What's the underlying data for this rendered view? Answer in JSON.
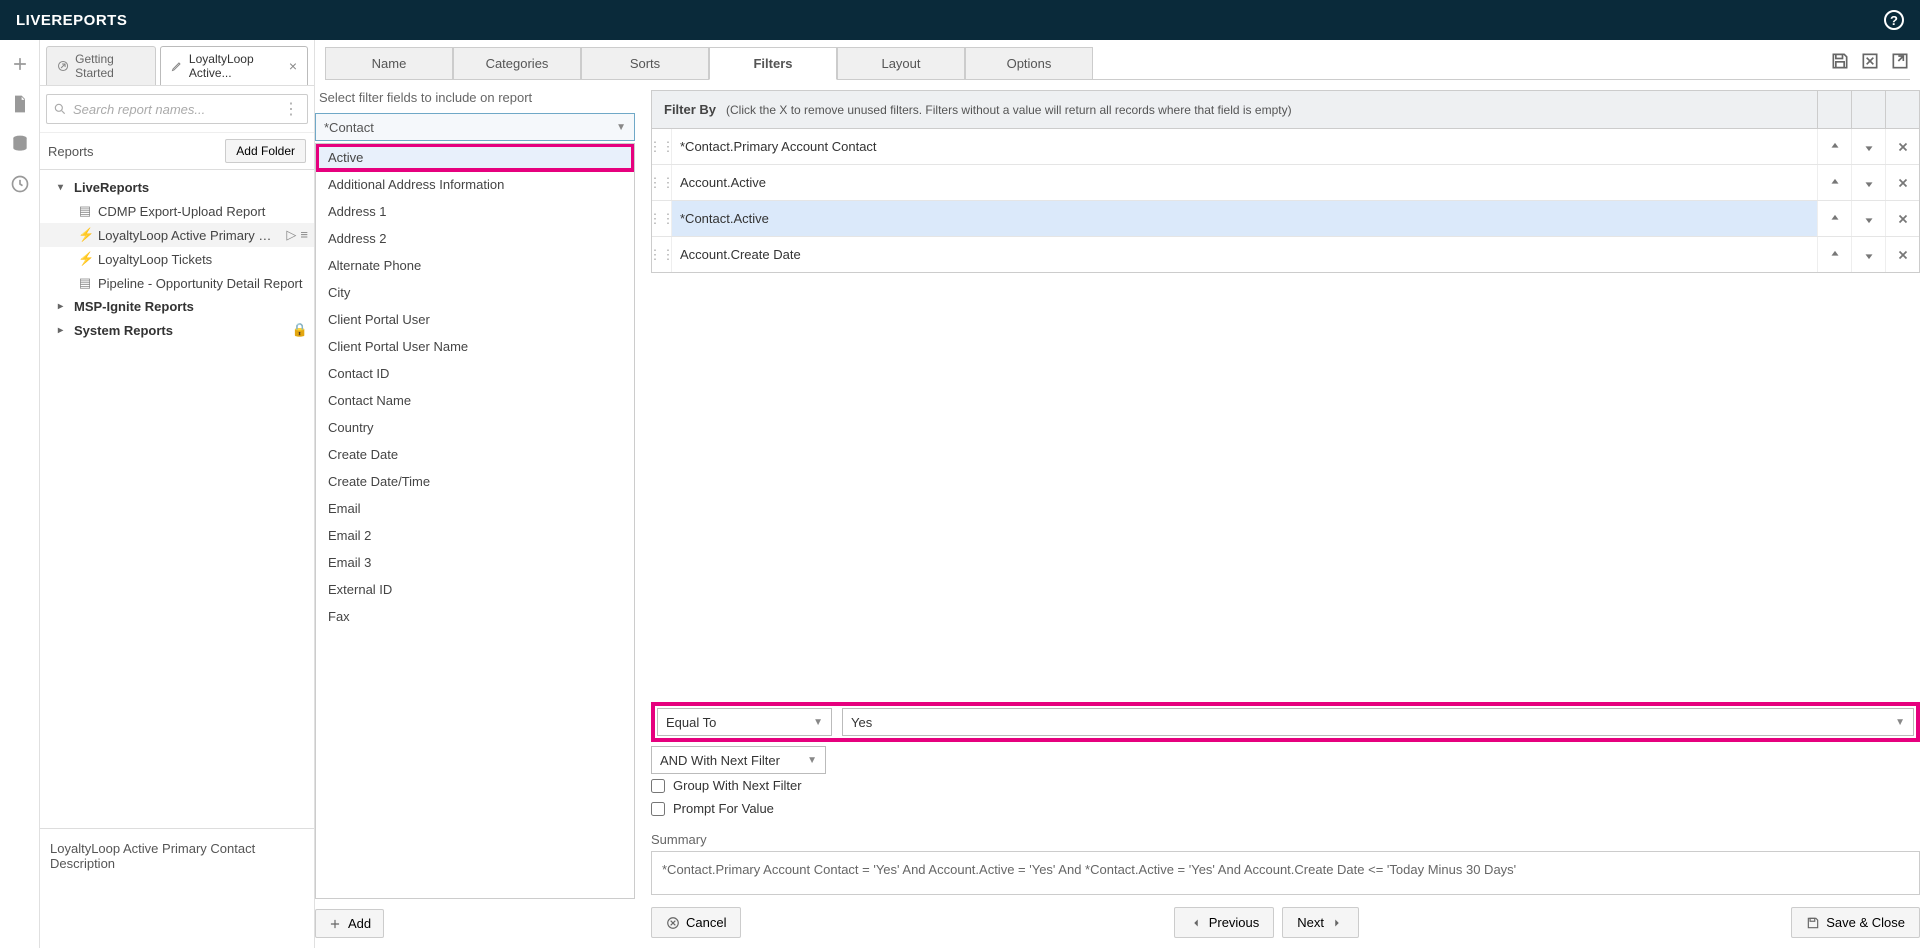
{
  "app": {
    "title": "LIVEREPORTS"
  },
  "tabs": [
    {
      "label": "Getting Started",
      "closable": false,
      "active": false
    },
    {
      "label": "LoyaltyLoop Active...",
      "closable": true,
      "active": true
    }
  ],
  "search": {
    "placeholder": "Search report names..."
  },
  "reports_panel": {
    "title": "Reports",
    "add_folder": "Add Folder",
    "folders": [
      {
        "label": "LiveReports",
        "expanded": true,
        "items": [
          {
            "label": "CDMP Export-Upload Report",
            "icon": "bars"
          },
          {
            "label": "LoyaltyLoop Active Primary Con",
            "icon": "bolt",
            "selected": true,
            "has_play": true
          },
          {
            "label": "LoyaltyLoop Tickets",
            "icon": "bolt"
          },
          {
            "label": "Pipeline - Opportunity Detail Report",
            "icon": "bars"
          }
        ]
      },
      {
        "label": "MSP-Ignite Reports",
        "expanded": false
      },
      {
        "label": "System Reports",
        "expanded": false,
        "locked": true
      }
    ]
  },
  "description": "LoyaltyLoop Active Primary Contact Description",
  "top_tabs": [
    "Name",
    "Categories",
    "Sorts",
    "Filters",
    "Layout",
    "Options"
  ],
  "top_tab_active": "Filters",
  "instruction": "Select filter fields to include on report",
  "field_combo": "*Contact",
  "field_list": [
    {
      "label": "Active",
      "highlighted": true
    },
    {
      "label": "Additional Address Information"
    },
    {
      "label": "Address 1"
    },
    {
      "label": "Address 2"
    },
    {
      "label": "Alternate Phone"
    },
    {
      "label": "City"
    },
    {
      "label": "Client Portal User"
    },
    {
      "label": "Client Portal User Name"
    },
    {
      "label": "Contact ID"
    },
    {
      "label": "Contact Name"
    },
    {
      "label": "Country"
    },
    {
      "label": "Create Date"
    },
    {
      "label": "Create Date/Time"
    },
    {
      "label": "Email"
    },
    {
      "label": "Email 2"
    },
    {
      "label": "Email 3"
    },
    {
      "label": "External ID"
    },
    {
      "label": "Fax"
    }
  ],
  "add_label": "Add",
  "filter_by": {
    "title": "Filter By",
    "hint": "(Click the X to remove unused filters. Filters without a value will return all records where that field is empty)"
  },
  "filter_rows": [
    {
      "name": "*Contact.Primary Account Contact"
    },
    {
      "name": "Account.Active"
    },
    {
      "name": "*Contact.Active",
      "selected": true
    },
    {
      "name": "Account.Create Date"
    }
  ],
  "controls": {
    "operator": "Equal To",
    "value": "Yes",
    "join": "AND With Next Filter",
    "group_label": "Group With Next Filter",
    "prompt_label": "Prompt For Value"
  },
  "summary": {
    "label": "Summary",
    "text": "*Contact.Primary Account Contact = 'Yes' And Account.Active = 'Yes' And *Contact.Active = 'Yes' And Account.Create Date <= 'Today Minus 30 Days'"
  },
  "buttons": {
    "cancel": "Cancel",
    "previous": "Previous",
    "next": "Next",
    "save_close": "Save & Close"
  }
}
